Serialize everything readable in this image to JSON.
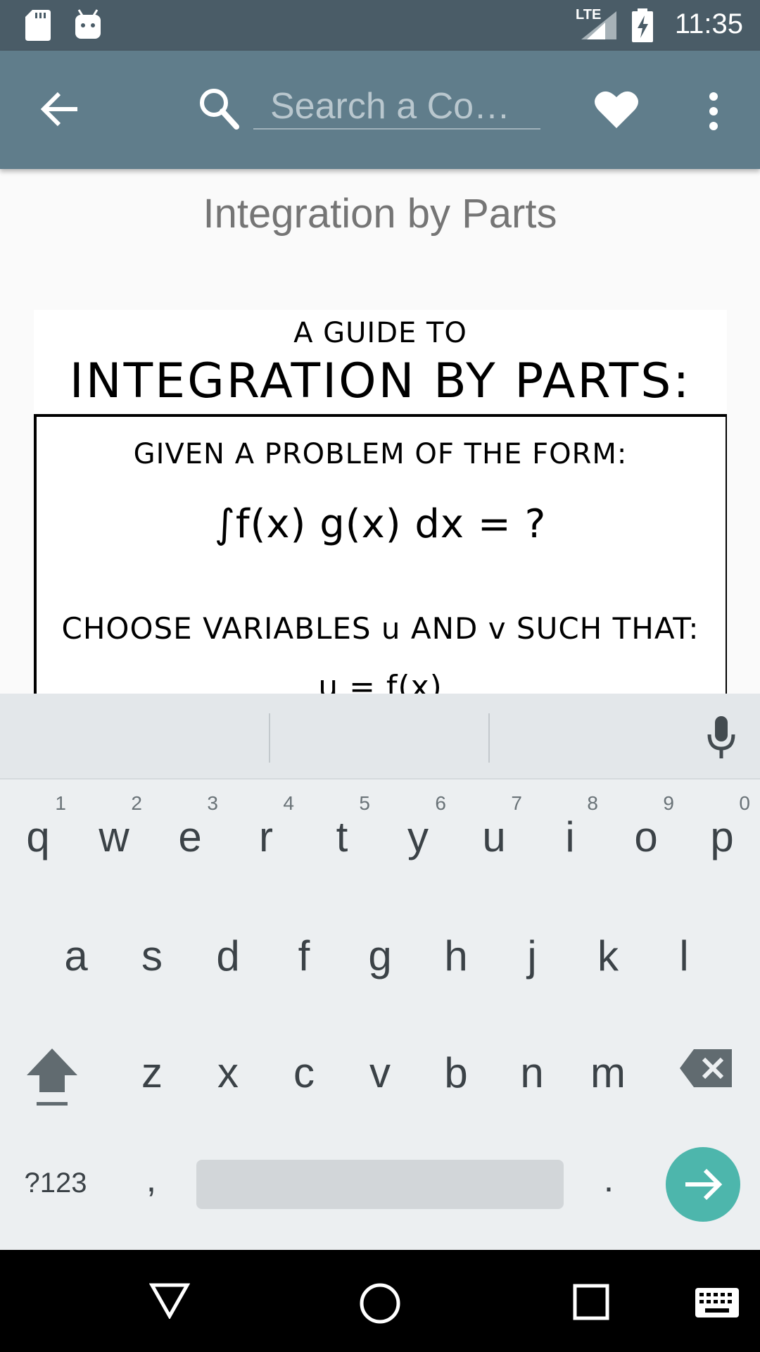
{
  "status_bar": {
    "time": "11:35",
    "network": "LTE",
    "icons": [
      "sd-card-icon",
      "android-icon",
      "lte-signal-icon",
      "battery-charging-icon"
    ]
  },
  "app_bar": {
    "back_icon": "arrow-left-icon",
    "search_icon": "search-icon",
    "search_placeholder": "Search a Co…",
    "favorite_icon": "heart-icon",
    "menu_icon": "more-vert-icon"
  },
  "content": {
    "title": "Integration by Parts",
    "comic": {
      "line1": "A GUIDE TO",
      "line2": "INTEGRATION BY PARTS:",
      "line3": "GIVEN A PROBLEM OF THE FORM:",
      "line4": "∫f(x) g(x) dx = ?",
      "line5": "CHOOSE VARIABLES u AND v SUCH THAT:",
      "line6": "u = f(x)"
    }
  },
  "keyboard": {
    "mic_icon": "microphone-icon",
    "row1": [
      {
        "ch": "q",
        "hint": "1"
      },
      {
        "ch": "w",
        "hint": "2"
      },
      {
        "ch": "e",
        "hint": "3"
      },
      {
        "ch": "r",
        "hint": "4"
      },
      {
        "ch": "t",
        "hint": "5"
      },
      {
        "ch": "y",
        "hint": "6"
      },
      {
        "ch": "u",
        "hint": "7"
      },
      {
        "ch": "i",
        "hint": "8"
      },
      {
        "ch": "o",
        "hint": "9"
      },
      {
        "ch": "p",
        "hint": "0"
      }
    ],
    "row2": [
      "a",
      "s",
      "d",
      "f",
      "g",
      "h",
      "j",
      "k",
      "l"
    ],
    "row3": [
      "z",
      "x",
      "c",
      "v",
      "b",
      "n",
      "m"
    ],
    "shift_icon": "shift-icon",
    "backspace_icon": "backspace-icon",
    "symbols_label": "?123",
    "comma_label": ",",
    "period_label": ".",
    "enter_icon": "arrow-right-icon"
  },
  "nav_bar": {
    "back_icon": "nav-back-icon",
    "home_icon": "nav-home-icon",
    "recents_icon": "nav-recents-icon",
    "keyboard_icon": "keyboard-icon"
  },
  "colors": {
    "status_bar": "#4a5c67",
    "app_bar": "#607d8b",
    "enter_key": "#4db6ac",
    "keyboard_bg": "#eceff1"
  }
}
